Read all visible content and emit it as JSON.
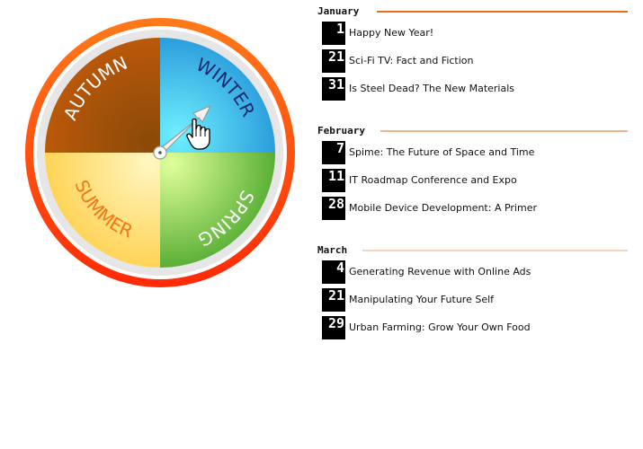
{
  "dial": {
    "seasons": [
      {
        "label": "WINTER",
        "color": "#2aa8e0",
        "text_color": "#1a2a6c"
      },
      {
        "label": "SPRING",
        "color": "#6cc23a",
        "text_color": "#ffffff"
      },
      {
        "label": "SUMMER",
        "color": "#ffd766",
        "text_color": "#f07818"
      },
      {
        "label": "AUTUMN",
        "color": "#b0540a",
        "text_color": "#ffffff"
      }
    ],
    "ring_color": "#ff4a10",
    "bezel_color": "#e6e6e6",
    "pointer_icon": "arrow-icon",
    "cursor_icon": "hand-cursor-icon"
  },
  "calendar": {
    "months": [
      {
        "name": "January",
        "line_color": "#e8701a",
        "events": [
          {
            "day": "1",
            "title": "Happy New Year!"
          },
          {
            "day": "21",
            "title": "Sci-Fi TV: Fact and Fiction"
          },
          {
            "day": "31",
            "title": "Is Steel Dead? The New Materials"
          }
        ]
      },
      {
        "name": "February",
        "line_color": "#f2b48a",
        "events": [
          {
            "day": "7",
            "title": "Spime: The Future of Space and Time"
          },
          {
            "day": "11",
            "title": "IT Roadmap Conference and Expo"
          },
          {
            "day": "28",
            "title": "Mobile Device Development: A Primer"
          }
        ]
      },
      {
        "name": "March",
        "line_color": "#f7d4bc",
        "events": [
          {
            "day": "4",
            "title": "Generating Revenue with Online Ads"
          },
          {
            "day": "21",
            "title": "Manipulating Your Future Self"
          },
          {
            "day": "29",
            "title": "Urban Farming: Grow Your Own Food"
          }
        ]
      }
    ]
  }
}
